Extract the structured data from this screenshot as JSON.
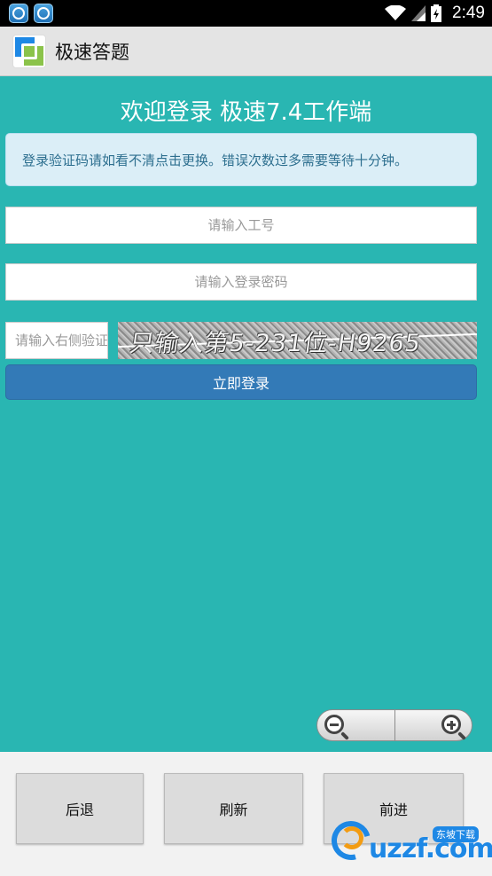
{
  "status_bar": {
    "time": "2:49",
    "icons": [
      "wifi-icon",
      "signal-icon",
      "battery-icon"
    ]
  },
  "app_bar": {
    "title": "极速答题"
  },
  "page": {
    "welcome": "欢迎登录 极速7.4工作端",
    "notice": "登录验证码请如看不清点击更换。错误次数过多需要等待十分钟。",
    "employee_id_placeholder": "请输入工号",
    "password_placeholder": "请输入登录密码",
    "captcha_placeholder": "请输入右侧验证",
    "captcha_text": "只输入第5-231位-H9265",
    "login_label": "立即登录"
  },
  "bottom_nav": {
    "back": "后退",
    "refresh": "刷新",
    "forward": "前进"
  },
  "watermark": {
    "brand": "uzzf.com",
    "tag": "东坡下载"
  },
  "colors": {
    "content_bg": "#29b6b2",
    "login_button": "#337ab7",
    "notice_bg": "#dbeef7"
  }
}
